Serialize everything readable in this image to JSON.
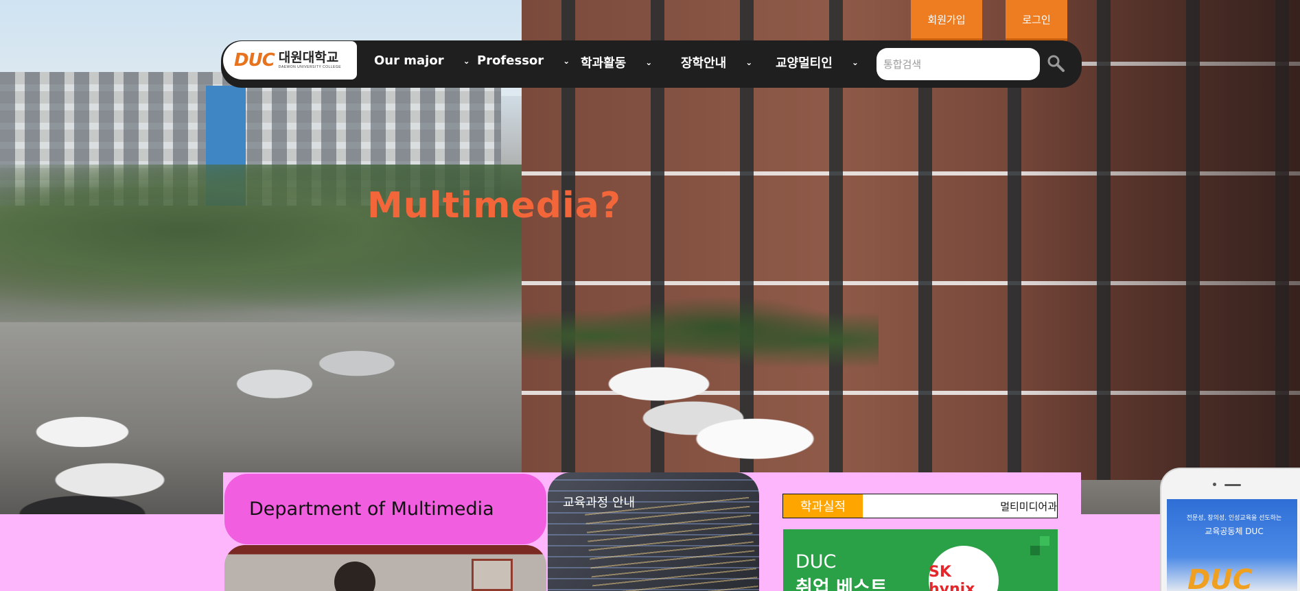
{
  "header": {
    "logo": {
      "mark": "DUC",
      "name_kr": "대원대학교",
      "name_en": "DAEWON UNIVERSITY COLLEGE"
    },
    "top_buttons": {
      "signup": "회원가입",
      "login": "로그인"
    },
    "menu": [
      {
        "label": "Our major"
      },
      {
        "label": "Professor"
      },
      {
        "label": "학과활동"
      },
      {
        "label": "장학안내"
      },
      {
        "label": "교양멀티인"
      }
    ],
    "search": {
      "placeholder": "통합검색",
      "value": ""
    }
  },
  "hero": {
    "title": "Multimedia?"
  },
  "content": {
    "department_title": "Department of Multimedia",
    "curriculum_label": "교육과정 안내",
    "news": {
      "tag": "학과실적",
      "ticker": "멀티미디어과"
    },
    "banner": {
      "line1": "DUC",
      "line2": "취업 베스트",
      "partner": "SK hynix"
    },
    "phone": {
      "line1": "전문성, 창의성, 인성교육을 선도하는",
      "line2": "교육공동체 DUC",
      "logo": "DUC"
    }
  },
  "colors": {
    "accent_orange": "#ee7d22",
    "nav_bg": "#1f1f1f",
    "page_pink": "#fdb6fb",
    "dept_magenta": "#f15fe0",
    "hero_title": "#f2663a",
    "news_tag": "#ffa500"
  }
}
